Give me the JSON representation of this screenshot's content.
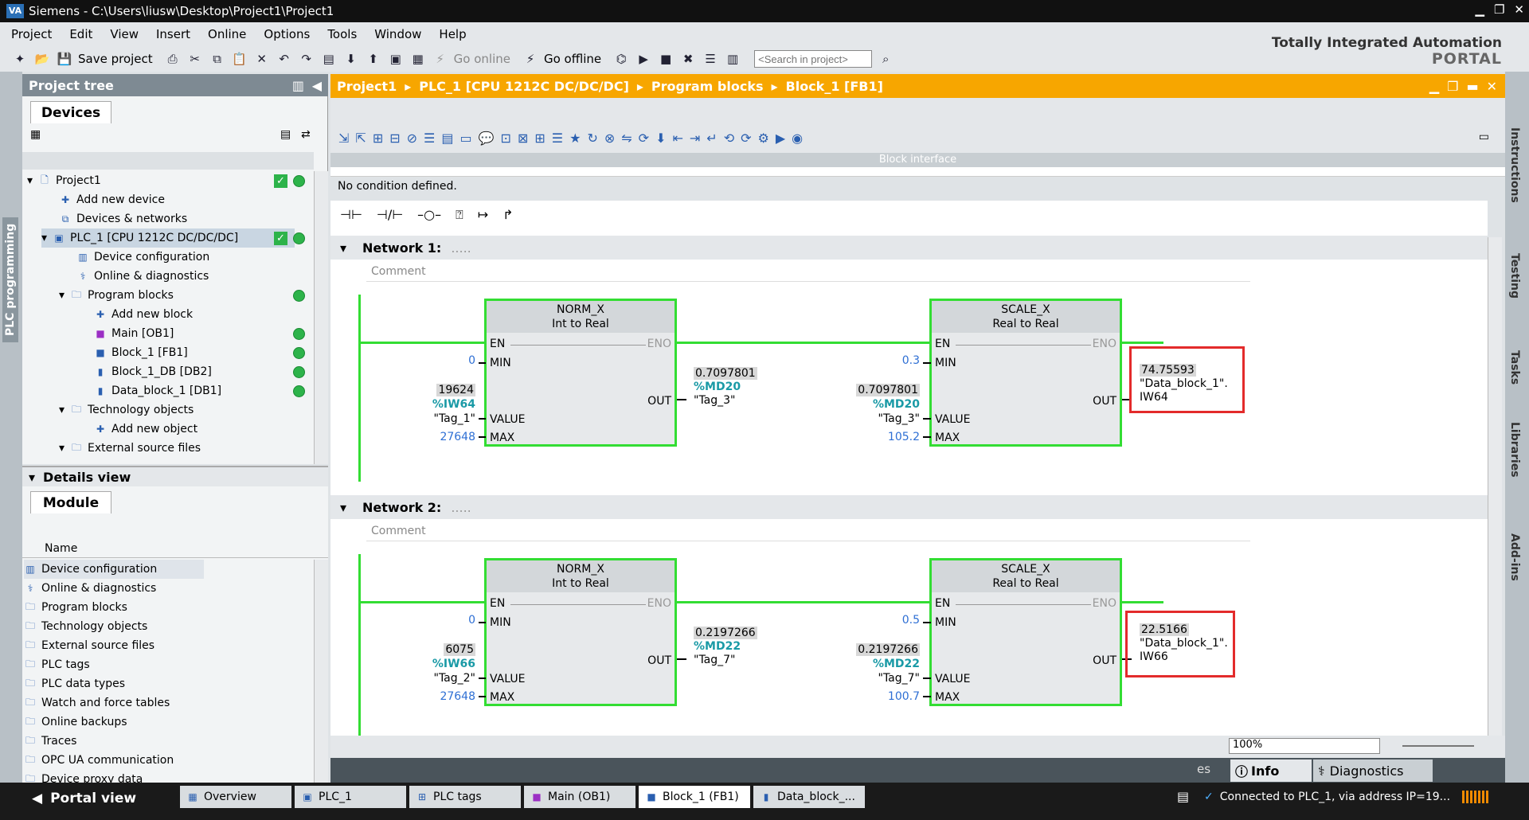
{
  "window": {
    "title": "Siemens - C:\\Users\\liusw\\Desktop\\Project1\\Project1",
    "logo": "VA"
  },
  "menu": [
    "Project",
    "Edit",
    "View",
    "Insert",
    "Online",
    "Options",
    "Tools",
    "Window",
    "Help"
  ],
  "toolbar": {
    "save_label": "Save project",
    "go_online": "Go online",
    "go_offline": "Go offline",
    "search_placeholder": "<Search in project>"
  },
  "brand": {
    "line1": "Totally Integrated Automation",
    "line2": "PORTAL"
  },
  "left_strip": {
    "label": "PLC programming"
  },
  "project_tree": {
    "title": "Project tree",
    "tab": "Devices",
    "items": [
      {
        "label": "Project1"
      },
      {
        "label": "Add new device"
      },
      {
        "label": "Devices & networks"
      },
      {
        "label": "PLC_1 [CPU 1212C DC/DC/DC]"
      },
      {
        "label": "Device configuration"
      },
      {
        "label": "Online & diagnostics"
      },
      {
        "label": "Program blocks"
      },
      {
        "label": "Add new block"
      },
      {
        "label": "Main [OB1]"
      },
      {
        "label": "Block_1 [FB1]"
      },
      {
        "label": "Block_1_DB [DB2]"
      },
      {
        "label": "Data_block_1 [DB1]"
      },
      {
        "label": "Technology objects"
      },
      {
        "label": "Add new object"
      },
      {
        "label": "External source files"
      }
    ]
  },
  "details_view": {
    "title": "Details view",
    "tab": "Module",
    "column": "Name",
    "items": [
      "Device configuration",
      "Online & diagnostics",
      "Program blocks",
      "Technology objects",
      "External source files",
      "PLC tags",
      "PLC data types",
      "Watch and force tables",
      "Online backups",
      "Traces",
      "OPC UA communication",
      "Device proxy data"
    ]
  },
  "editor": {
    "breadcrumb": [
      "Project1",
      "PLC_1 [CPU 1212C DC/DC/DC]",
      "Program blocks",
      "Block_1 [FB1]"
    ],
    "block_interface": "Block interface",
    "condition": "No condition defined.",
    "networks": [
      {
        "title": "Network 1:",
        "dots": ".....",
        "comment": "Comment",
        "norm": {
          "name": "NORM_X",
          "types": "Int  to  Real",
          "min": "0",
          "value_val": "19624",
          "value_addr": "%IW64",
          "value_tag": "\"Tag_1\"",
          "max": "27648",
          "out_val": "0.7097801",
          "out_addr": "%MD20",
          "out_tag": "\"Tag_3\""
        },
        "scale": {
          "name": "SCALE_X",
          "types": "Real  to  Real",
          "min": "0.3",
          "value_val": "0.7097801",
          "value_addr": "%MD20",
          "value_tag": "\"Tag_3\"",
          "max": "105.2",
          "out_val": "74.75593",
          "out_tag": "\"Data_block_1\".",
          "out_member": "IW64"
        }
      },
      {
        "title": "Network 2:",
        "dots": ".....",
        "comment": "Comment",
        "norm": {
          "name": "NORM_X",
          "types": "Int  to  Real",
          "min": "0",
          "value_val": "6075",
          "value_addr": "%IW66",
          "value_tag": "\"Tag_2\"",
          "max": "27648",
          "out_val": "0.2197266",
          "out_addr": "%MD22",
          "out_tag": "\"Tag_7\""
        },
        "scale": {
          "name": "SCALE_X",
          "types": "Real  to  Real",
          "min": "0.5",
          "value_val": "0.2197266",
          "value_addr": "%MD22",
          "value_tag": "\"Tag_7\"",
          "max": "100.7",
          "out_val": "22.5166",
          "out_tag": "\"Data_block_1\".",
          "out_member": "IW66"
        }
      }
    ],
    "pins": {
      "en": "EN",
      "eno": "ENO",
      "min": "MIN",
      "value": "VALUE",
      "max": "MAX",
      "out": "OUT"
    },
    "zoom": "100%"
  },
  "right_strip": [
    "Instructions",
    "Testing",
    "Tasks",
    "Libraries",
    "Add-ins"
  ],
  "inspector_tabs": {
    "info": "Info",
    "diagnostics": "Diagnostics",
    "partial": "es"
  },
  "bottom_tabs": [
    "Overview",
    "PLC_1",
    "PLC tags",
    "Main (OB1)",
    "Block_1 (FB1)",
    "Data_block_..."
  ],
  "status": {
    "portal_view": "Portal view",
    "connected": "Connected to PLC_1, via address IP=19..."
  },
  "colors": {
    "accent_orange": "#f7a600",
    "ok_green": "#2db34a",
    "network_green": "#33dd33",
    "highlight_red": "#e32b2b"
  }
}
